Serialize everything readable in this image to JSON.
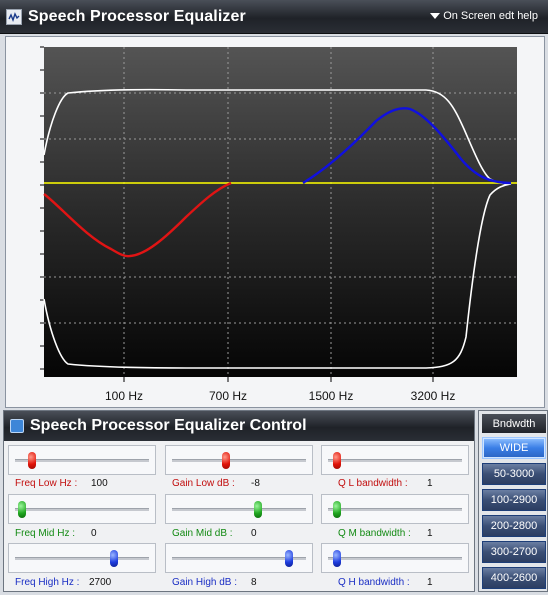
{
  "window": {
    "title": "Speech Processor Equalizer",
    "help_label": "On Screen edt help",
    "icon": "equalizer-app-icon"
  },
  "graph": {
    "x_tick_labels": [
      "100 Hz",
      "700 Hz",
      "1500 Hz",
      "3200 Hz"
    ],
    "colors": {
      "low_curve": "#e01414",
      "high_curve": "#1010e0",
      "zero_line": "#ffff00",
      "envelope": "#ffffff"
    }
  },
  "control": {
    "title": "Speech Processor Equalizer Control",
    "freq_low": {
      "label": "Freq Low Hz :",
      "value": "100",
      "level": 0.1
    },
    "gain_low": {
      "label": "Gain Low dB :",
      "value": "-8",
      "level": 0.4
    },
    "q_low": {
      "label": "Q L bandwidth :",
      "value": "1",
      "level": 0.04
    },
    "freq_mid": {
      "label": "Freq Mid Hz :",
      "value": "0",
      "level": 0.02
    },
    "gain_mid": {
      "label": "Gain Mid dB :",
      "value": "0",
      "level": 0.65
    },
    "q_mid": {
      "label": "Q M bandwidth :",
      "value": "1",
      "level": 0.04
    },
    "freq_high": {
      "label": "Freq High Hz :",
      "value": "2700",
      "level": 0.75
    },
    "gain_high": {
      "label": "Gain High dB :",
      "value": "8",
      "level": 0.9
    },
    "q_high": {
      "label": "Q H bandwidth :",
      "value": "1",
      "level": 0.04
    }
  },
  "bandwidth": {
    "header": "Bndwdth",
    "options": [
      "WIDE",
      "50-3000",
      "100-2900",
      "200-2800",
      "300-2700",
      "400-2600"
    ],
    "selected": "WIDE"
  }
}
